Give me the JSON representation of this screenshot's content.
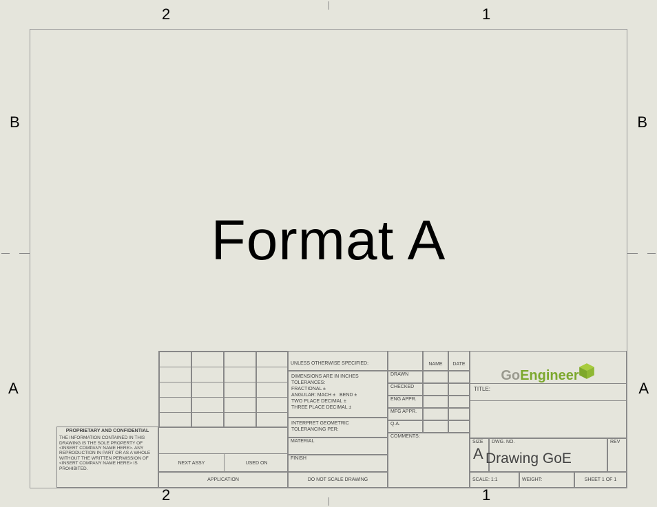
{
  "rulers": {
    "top": {
      "col2": "2",
      "col1": "1"
    },
    "bottom": {
      "col2": "2",
      "col1": "1"
    },
    "left": {
      "rowB": "B",
      "rowA": "A"
    },
    "right": {
      "rowB": "B",
      "rowA": "A"
    }
  },
  "center_text": "Format A",
  "proprietary": {
    "title": "PROPRIETARY AND CONFIDENTIAL",
    "body": "THE INFORMATION CONTAINED IN THIS DRAWING IS THE SOLE PROPERTY OF <INSERT COMPANY NAME HERE>. ANY REPRODUCTION IN PART OR AS A WHOLE WITHOUT THE WRITTEN PERMISSION OF <INSERT COMPANY NAME HERE> IS PROHIBITED."
  },
  "titleblock": {
    "unless": "UNLESS OTHERWISE SPECIFIED:",
    "tolerances_lines": {
      "l1": "DIMENSIONS ARE IN INCHES",
      "l2": "TOLERANCES:",
      "l3": "FRACTIONAL ±",
      "l4a": "ANGULAR: MACH ±",
      "l4b": "BEND ±",
      "l5": "TWO PLACE DECIMAL    ±",
      "l6": "THREE PLACE DECIMAL  ±"
    },
    "interpret1": "INTERPRET GEOMETRIC",
    "interpret2": "TOLERANCING PER:",
    "material": "MATERIAL",
    "finish": "FINISH",
    "do_not_scale": "DO NOT SCALE DRAWING",
    "next_assy": "NEXT ASSY",
    "used_on": "USED ON",
    "application": "APPLICATION",
    "name": "NAME",
    "date": "DATE",
    "drawn": "DRAWN",
    "checked": "CHECKED",
    "eng_appr": "ENG APPR.",
    "mfg_appr": "MFG APPR.",
    "qa": "Q.A.",
    "comments": "COMMENTS:",
    "title_label": "TITLE:",
    "size_label": "SIZE",
    "size_value": "A",
    "dwg_no_label": "DWG.  NO.",
    "dwg_no_value": "Drawing GoE",
    "rev_label": "REV",
    "scale": "SCALE: 1:1",
    "weight": "WEIGHT:",
    "sheet": "SHEET 1 OF 1"
  },
  "logo": {
    "part1": "Go",
    "part2": "Engineer"
  }
}
